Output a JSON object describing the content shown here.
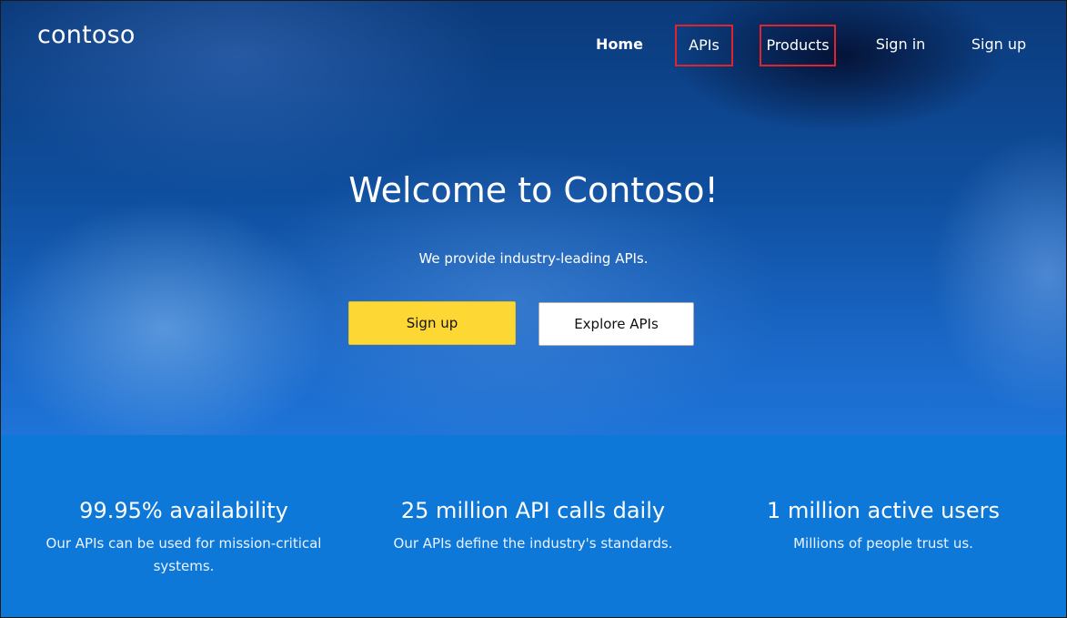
{
  "brand": {
    "logo_text": "contoso"
  },
  "nav": {
    "items": [
      {
        "label": "Home"
      },
      {
        "label": "APIs"
      },
      {
        "label": "Products"
      },
      {
        "label": "Sign in"
      },
      {
        "label": "Sign up"
      }
    ]
  },
  "hero": {
    "title": "Welcome to Contoso!",
    "subtitle": "We provide industry-leading APIs.",
    "primary_button": "Sign up",
    "secondary_button": "Explore APIs"
  },
  "stats": [
    {
      "title": "99.95% availability",
      "description": "Our APIs can be used for mission-critical systems."
    },
    {
      "title": "25 million API calls daily",
      "description": "Our APIs define the industry's standards."
    },
    {
      "title": "1 million active users",
      "description": "Millions of people trust us."
    }
  ],
  "colors": {
    "highlight_border": "#e0242c",
    "primary_button": "#fdd835",
    "stats_background": "#0e78d8",
    "hero_dark": "#0b3a7a"
  }
}
